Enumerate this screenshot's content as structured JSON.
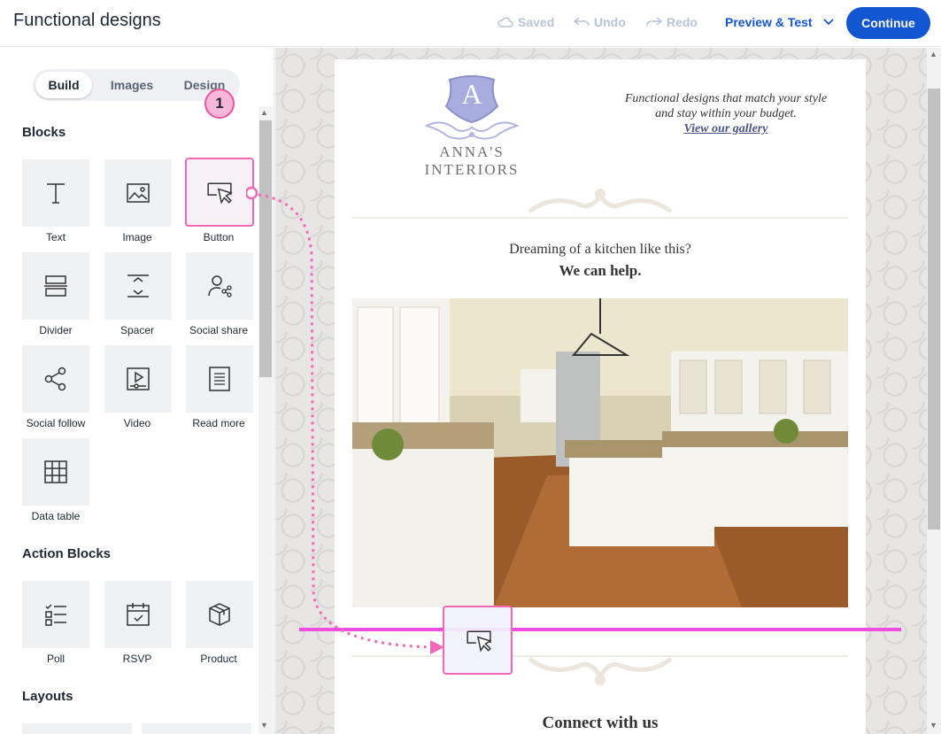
{
  "header": {
    "title": "Functional designs",
    "saved": "Saved",
    "undo": "Undo",
    "redo": "Redo",
    "preview": "Preview & Test",
    "continue": "Continue"
  },
  "sidebar": {
    "tabs": [
      "Build",
      "Images",
      "Design"
    ],
    "blocks_heading": "Blocks",
    "blocks": [
      {
        "label": "Text",
        "icon": "text-icon"
      },
      {
        "label": "Image",
        "icon": "image-icon"
      },
      {
        "label": "Button",
        "icon": "button-cursor-icon"
      },
      {
        "label": "Divider",
        "icon": "divider-icon"
      },
      {
        "label": "Spacer",
        "icon": "spacer-icon"
      },
      {
        "label": "Social share",
        "icon": "social-share-icon"
      },
      {
        "label": "Social follow",
        "icon": "social-follow-icon"
      },
      {
        "label": "Video",
        "icon": "video-icon"
      },
      {
        "label": "Read more",
        "icon": "read-more-icon"
      },
      {
        "label": "Data table",
        "icon": "data-table-icon"
      }
    ],
    "action_heading": "Action Blocks",
    "action_blocks": [
      {
        "label": "Poll",
        "icon": "poll-icon"
      },
      {
        "label": "RSVP",
        "icon": "calendar-icon"
      },
      {
        "label": "Product",
        "icon": "product-box-icon"
      }
    ],
    "layouts_heading": "Layouts"
  },
  "callout": {
    "step": "1"
  },
  "email": {
    "logo_letter": "A",
    "brand": "ANNA'S INTERIORS",
    "tagline_1": "Functional designs that match your style",
    "tagline_2": "and stay within your budget.",
    "gallery_link": "View our gallery",
    "headline_1": "Dreaming of a kitchen like this?",
    "headline_2": "We can help.",
    "connect": "Connect with us"
  },
  "colors": {
    "accent": "#1356d1",
    "highlight": "#f268b6",
    "drop_line": "#f04ee0"
  }
}
